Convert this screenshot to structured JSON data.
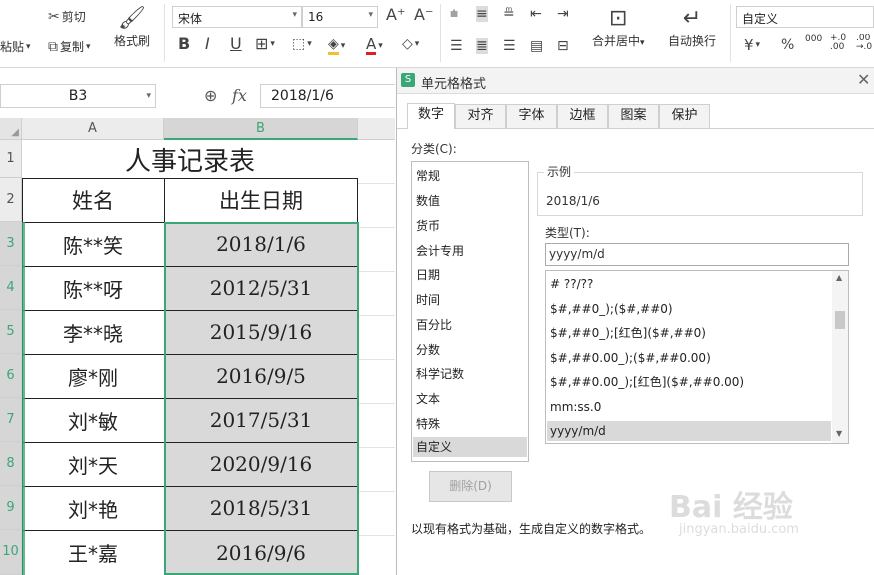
{
  "ribbon": {
    "cut": "剪切",
    "paste": "粘贴",
    "copy": "复制",
    "format_painter": "格式刷",
    "font_name": "宋体",
    "font_size": "16",
    "merge_center": "合并居中",
    "wrap_text": "自动换行",
    "number_format": "自定义",
    "currency": "¥",
    "percent": "%",
    "thousands": "000",
    "inc_decimal": "+.0 .00",
    "dec_decimal": ".00 →.0"
  },
  "formula_bar": {
    "name_box": "B3",
    "fx": "fx",
    "value": "2018/1/6"
  },
  "sheet": {
    "columns": [
      "A",
      "B"
    ],
    "rows": [
      "1",
      "2",
      "3",
      "4",
      "5",
      "6",
      "7",
      "8",
      "9",
      "10"
    ],
    "title": "人事记录表",
    "headers": [
      "姓名",
      "出生日期"
    ],
    "data": [
      [
        "陈**笑",
        "2018/1/6"
      ],
      [
        "陈**呀",
        "2012/5/31"
      ],
      [
        "李**晓",
        "2015/9/16"
      ],
      [
        "廖*刚",
        "2016/9/5"
      ],
      [
        "刘*敏",
        "2017/5/31"
      ],
      [
        "刘*天",
        "2020/9/16"
      ],
      [
        "刘*艳",
        "2018/5/31"
      ],
      [
        "王*嘉",
        "2016/9/6"
      ]
    ],
    "selection_color": "#3aa776"
  },
  "dialog": {
    "title": "单元格格式",
    "tabs": [
      "数字",
      "对齐",
      "字体",
      "边框",
      "图案",
      "保护"
    ],
    "category_label": "分类(C):",
    "categories": [
      "常规",
      "数值",
      "货币",
      "会计专用",
      "日期",
      "时间",
      "百分比",
      "分数",
      "科学记数",
      "文本",
      "特殊",
      "自定义"
    ],
    "sample_label": "示例",
    "sample_value": "2018/1/6",
    "type_label": "类型(T):",
    "type_value": "yyyy/m/d",
    "type_list": [
      "# ??/??",
      "$#,##0_);($#,##0)",
      "$#,##0_);[红色]($#,##0)",
      "$#,##0.00_);($#,##0.00)",
      "$#,##0.00_);[红色]($#,##0.00)",
      "mm:ss.0",
      "yyyy/m/d"
    ],
    "delete_button": "删除(D)",
    "description": "以现有格式为基础，生成自定义的数字格式。"
  },
  "watermark": {
    "brand": "Bai 经验",
    "url": "jingyan.baidu.com"
  }
}
